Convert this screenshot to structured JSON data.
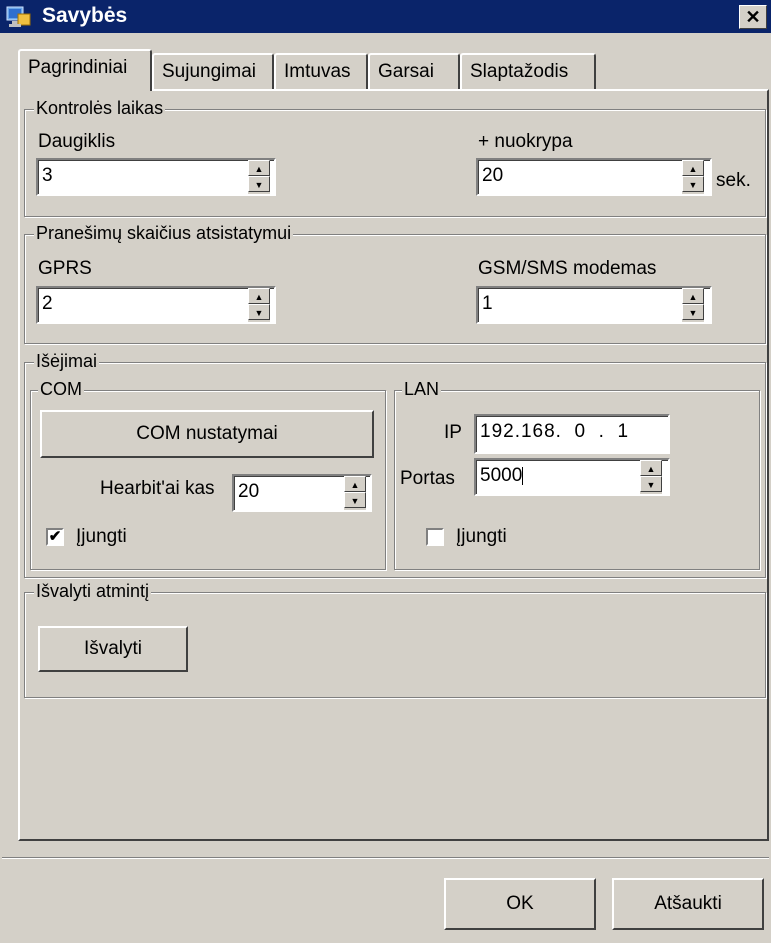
{
  "window": {
    "title": "Savybės",
    "close_glyph": "✕"
  },
  "tabs": [
    {
      "label": "Pagrindiniai"
    },
    {
      "label": "Sujungimai"
    },
    {
      "label": "Imtuvas"
    },
    {
      "label": "Garsai"
    },
    {
      "label": "Slaptažodis"
    }
  ],
  "control_time": {
    "legend": "Kontrolės laikas",
    "multiplier_label": "Daugiklis",
    "multiplier_value": "3",
    "deviation_label": "+ nuokrypa",
    "deviation_value": "20",
    "deviation_unit": "sek."
  },
  "restore_count": {
    "legend": "Pranešimų skaičius atsistatymui",
    "gprs_label": "GPRS",
    "gprs_value": "2",
    "gsm_label": "GSM/SMS modemas",
    "gsm_value": "1"
  },
  "outputs": {
    "legend": "Išėjimai",
    "com": {
      "legend": "COM",
      "settings_button": "COM nustatymai",
      "heartbeat_label": "Hearbit'ai kas",
      "heartbeat_value": "20",
      "enable_label": "Įjungti",
      "enabled": true
    },
    "lan": {
      "legend": "LAN",
      "ip_label": "IP",
      "ip_value": "192.168.  0  .  1",
      "port_label": "Portas",
      "port_value": "5000",
      "enable_label": "Įjungti",
      "enabled": false
    }
  },
  "clear_memory": {
    "legend": "Išvalyti atmintį",
    "button": "Išvalyti"
  },
  "footer": {
    "ok": "OK",
    "cancel": "Atšaukti"
  },
  "icons": {
    "app": "computer-network-icon",
    "spin_up": "▲",
    "spin_down": "▼",
    "check": "✔"
  }
}
